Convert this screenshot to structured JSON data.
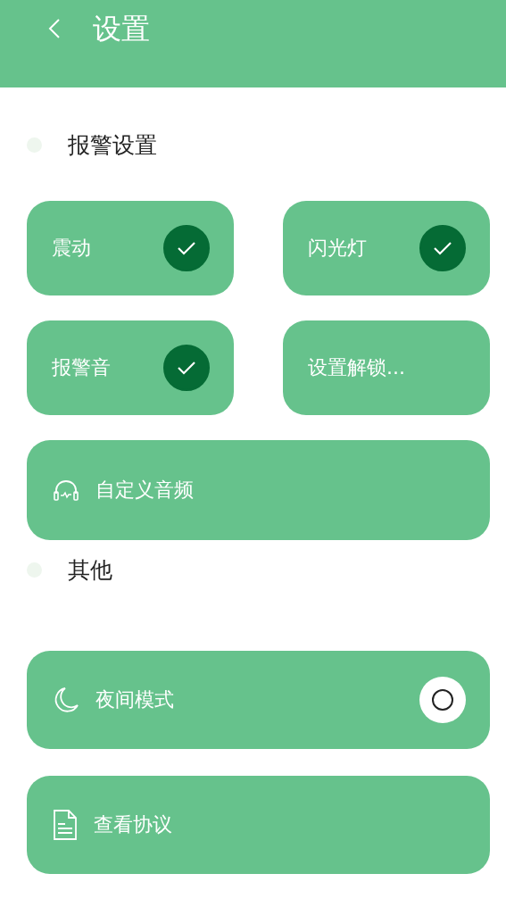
{
  "header": {
    "title": "设置"
  },
  "alarm": {
    "title": "报警设置",
    "tiles": [
      {
        "label": "震动",
        "kind": "check",
        "checked": true
      },
      {
        "label": "闪光灯",
        "kind": "check",
        "checked": true
      },
      {
        "label": "报警音",
        "kind": "check",
        "checked": true
      },
      {
        "label": "设置解锁...",
        "kind": "plain"
      }
    ],
    "audio_row": {
      "label": "自定义音频"
    }
  },
  "other": {
    "title": "其他",
    "rows": [
      {
        "label": "夜间模式",
        "kind": "toggle",
        "on": false
      },
      {
        "label": "查看协议",
        "kind": "document"
      }
    ]
  }
}
